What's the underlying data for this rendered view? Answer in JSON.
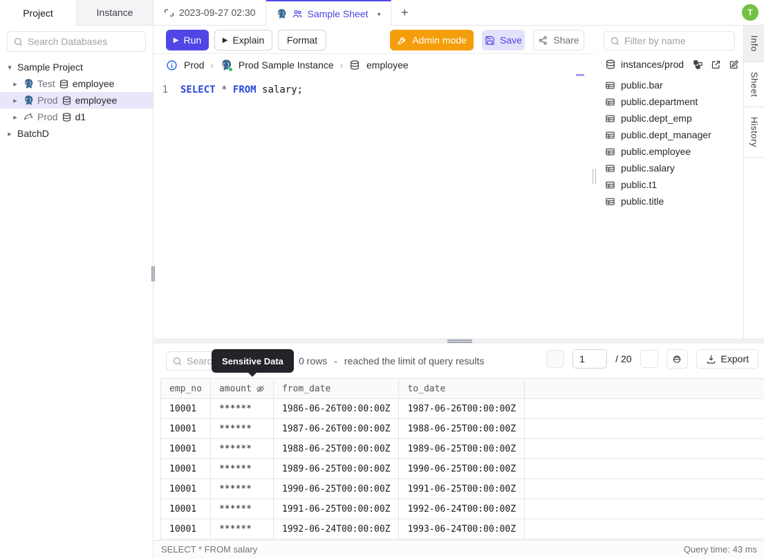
{
  "header": {
    "left_tabs": {
      "project": "Project",
      "instance": "Instance"
    },
    "editor_tabs": {
      "tab1": "2023-09-27 02:30",
      "tab2": "Sample Sheet",
      "new_tab": "+"
    },
    "avatar_initial": "T"
  },
  "left_sidebar": {
    "search_placeholder": "Search Databases",
    "tree": {
      "root": "Sample Project",
      "items": [
        {
          "env": "Test",
          "db": "employee",
          "engine": "postgresql"
        },
        {
          "env": "Prod",
          "db": "employee",
          "engine": "postgresql"
        },
        {
          "env": "Prod",
          "db": "d1",
          "engine": "mysql"
        }
      ],
      "batch_project": "BatchD"
    }
  },
  "toolbar": {
    "run": "Run",
    "explain": "Explain",
    "format": "Format",
    "admin_mode": "Admin mode",
    "save": "Save",
    "share": "Share"
  },
  "breadcrumb": {
    "environment": "Prod",
    "instance": "Prod Sample Instance",
    "database": "employee"
  },
  "editor": {
    "line_number": "1",
    "kw_select": "SELECT",
    "star": "*",
    "kw_from": "FROM",
    "rest": "salary;"
  },
  "right_sidebar": {
    "filter_placeholder": "Filter by name",
    "connection": "instances/prod",
    "tables": [
      "public.bar",
      "public.department",
      "public.dept_emp",
      "public.dept_manager",
      "public.employee",
      "public.salary",
      "public.t1",
      "public.title"
    ]
  },
  "side_tabs": {
    "info": "Info",
    "sheet": "Sheet",
    "history": "History"
  },
  "results": {
    "search_placeholder": "Search",
    "tooltip": "Sensitive Data",
    "rows_count": "0 rows",
    "dash": "-",
    "limit_note": "reached the limit of query results",
    "page_value": "1",
    "page_total": "/ 20",
    "export_label": "Export",
    "table": {
      "columns": [
        "emp_no",
        "amount",
        "from_date",
        "to_date"
      ],
      "masked_column": "amount",
      "rows": [
        [
          "10001",
          "******",
          "1986-06-26T00:00:00Z",
          "1987-06-26T00:00:00Z"
        ],
        [
          "10001",
          "******",
          "1987-06-26T00:00:00Z",
          "1988-06-25T00:00:00Z"
        ],
        [
          "10001",
          "******",
          "1988-06-25T00:00:00Z",
          "1989-06-25T00:00:00Z"
        ],
        [
          "10001",
          "******",
          "1989-06-25T00:00:00Z",
          "1990-06-25T00:00:00Z"
        ],
        [
          "10001",
          "******",
          "1990-06-25T00:00:00Z",
          "1991-06-25T00:00:00Z"
        ],
        [
          "10001",
          "******",
          "1991-06-25T00:00:00Z",
          "1992-06-24T00:00:00Z"
        ],
        [
          "10001",
          "******",
          "1992-06-24T00:00:00Z",
          "1993-06-24T00:00:00Z"
        ]
      ]
    },
    "status_query": "SELECT * FROM salary",
    "status_time": "Query time: 43 ms"
  },
  "colors": {
    "accent": "#4f46e5",
    "admin_orange": "#f59e0b",
    "avatar_green": "#74c043",
    "postgres_blue": "#336791",
    "tooltip_bg": "#232329"
  }
}
